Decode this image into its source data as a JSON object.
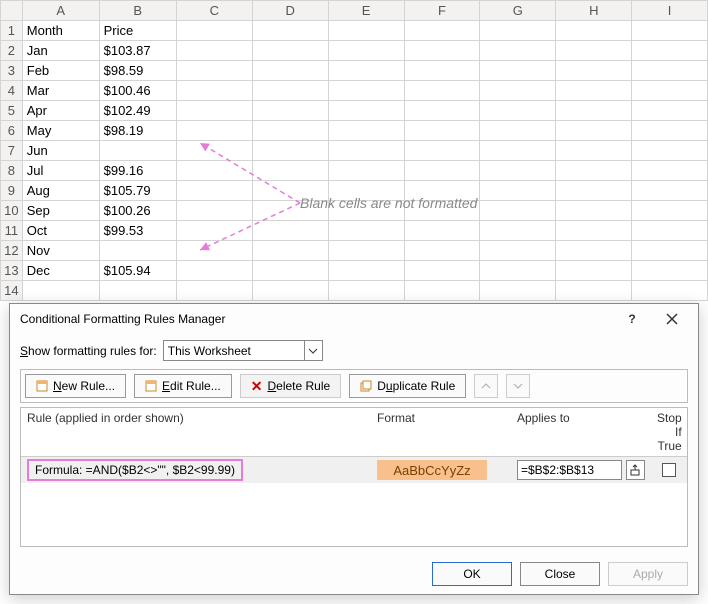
{
  "spreadsheet": {
    "columns": [
      "A",
      "B",
      "C",
      "D",
      "E",
      "F",
      "G",
      "H",
      "I"
    ],
    "headers": {
      "A": "Month",
      "B": "Price"
    },
    "rows": [
      {
        "n": 1,
        "A": "Month",
        "B": "Price",
        "boldA": true,
        "boldB": true
      },
      {
        "n": 2,
        "A": "Jan",
        "B": "$103.87"
      },
      {
        "n": 3,
        "A": "Feb",
        "B": "$98.59",
        "hlB": true
      },
      {
        "n": 4,
        "A": "Mar",
        "B": "$100.46"
      },
      {
        "n": 5,
        "A": "Apr",
        "B": "$102.49"
      },
      {
        "n": 6,
        "A": "May",
        "B": "$98.19",
        "hlB": true
      },
      {
        "n": 7,
        "A": "Jun",
        "B": ""
      },
      {
        "n": 8,
        "A": "Jul",
        "B": "$99.16",
        "hlB": true
      },
      {
        "n": 9,
        "A": "Aug",
        "B": "$105.79"
      },
      {
        "n": 10,
        "A": "Sep",
        "B": "$100.26"
      },
      {
        "n": 11,
        "A": "Oct",
        "B": "$99.53",
        "hlB": true
      },
      {
        "n": 12,
        "A": "Nov",
        "B": ""
      },
      {
        "n": 13,
        "A": "Dec",
        "B": "$105.94"
      },
      {
        "n": 14,
        "A": "",
        "B": ""
      }
    ]
  },
  "annotation": "Blank cells are not formatted",
  "dialog": {
    "title": "Conditional Formatting Rules Manager",
    "show_label": "Show formatting rules for:",
    "show_value": "This Worksheet",
    "buttons": {
      "new": "New Rule...",
      "edit": "Edit Rule...",
      "delete": "Delete Rule",
      "duplicate": "Duplicate Rule"
    },
    "list": {
      "col_rule": "Rule (applied in order shown)",
      "col_format": "Format",
      "col_applies": "Applies to",
      "col_stop": "Stop If True",
      "row": {
        "formula": "Formula: =AND($B2<>\"\", $B2<99.99)",
        "format_preview": "AaBbCcYyZz",
        "applies_to": "=$B$2:$B$13"
      }
    },
    "footer": {
      "ok": "OK",
      "close": "Close",
      "apply": "Apply"
    }
  }
}
